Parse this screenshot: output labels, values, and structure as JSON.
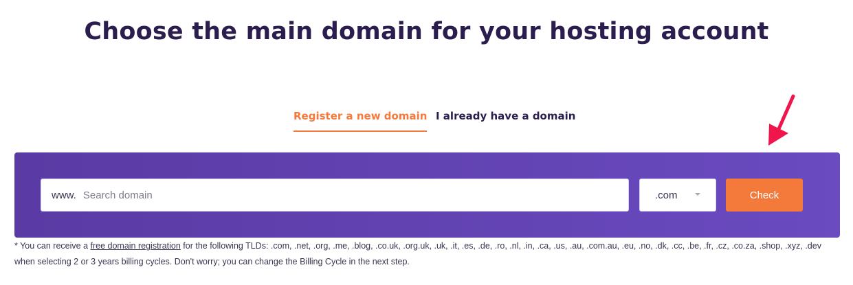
{
  "header": {
    "title": "Choose the main domain for your hosting account"
  },
  "tabs": [
    {
      "label": "Register a new domain",
      "active": true
    },
    {
      "label": "I already have a domain",
      "active": false
    }
  ],
  "search": {
    "prefix": "www.",
    "placeholder": "Search domain",
    "value": "",
    "tld_selected": ".com",
    "check_label": "Check"
  },
  "note": {
    "prefix": "* You can receive a ",
    "link_text": "free domain registration",
    "suffix": " for the following TLDs: .com, .net, .org, .me, .blog, .co.uk, .org.uk, .uk, .it, .es, .de, .ro, .nl, .in, .ca, .us, .au, .com.au, .eu, .no, .dk, .cc, .be, .fr, .cz, .co.za, .shop, .xyz, .dev when selecting 2 or 3 years billing cycles. Don't worry; you can change the Billing Cycle in the next step."
  },
  "annotation": {
    "icon": "arrow-down-left-icon",
    "color": "#f0154a"
  },
  "colors": {
    "accent": "#f47a3c",
    "heading": "#2b1d4d",
    "panel_start": "#5a3aa3",
    "panel_end": "#6a4bc0"
  }
}
